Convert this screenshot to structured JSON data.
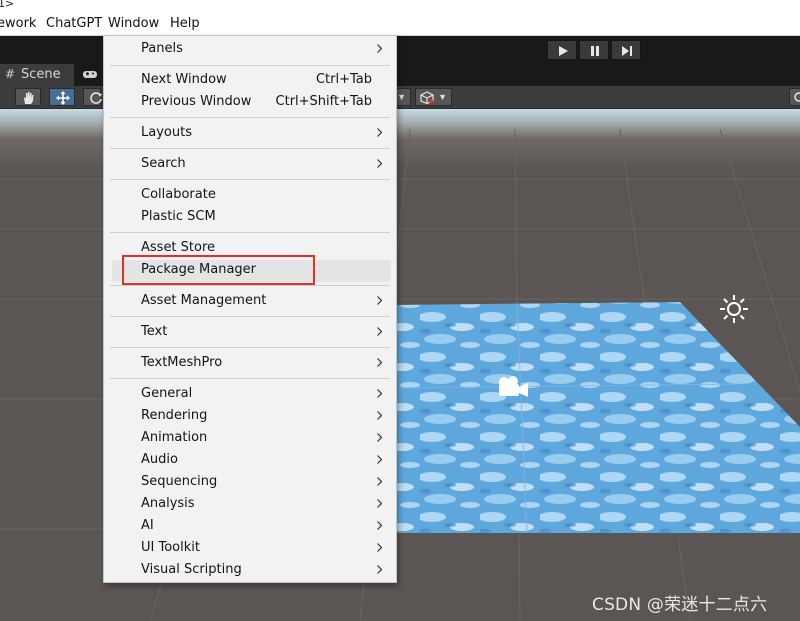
{
  "title_strip": {
    "text": "1>"
  },
  "menubar": {
    "items": [
      "ework",
      "ChatGPT",
      "Window",
      "Help"
    ]
  },
  "tabs": {
    "scene_label": "Scene"
  },
  "colors": {
    "highlight_box": "#e0302a",
    "menu_bg": "#f2f2f2",
    "tool_active": "#466d96"
  },
  "window_menu": {
    "panels": "Panels",
    "next_window": "Next Window",
    "next_window_shortcut": "Ctrl+Tab",
    "previous_window": "Previous Window",
    "previous_window_shortcut": "Ctrl+Shift+Tab",
    "layouts": "Layouts",
    "search": "Search",
    "collaborate": "Collaborate",
    "plastic_scm": "Plastic SCM",
    "asset_store": "Asset Store",
    "package_manager": "Package Manager",
    "asset_management": "Asset Management",
    "text": "Text",
    "textmeshpro": "TextMeshPro",
    "general": "General",
    "rendering": "Rendering",
    "animation": "Animation",
    "audio": "Audio",
    "sequencing": "Sequencing",
    "analysis": "Analysis",
    "ai": "AI",
    "ui_toolkit": "UI Toolkit",
    "visual_scripting": "Visual Scripting"
  },
  "watermark": "CSDN @荣迷十二点六"
}
